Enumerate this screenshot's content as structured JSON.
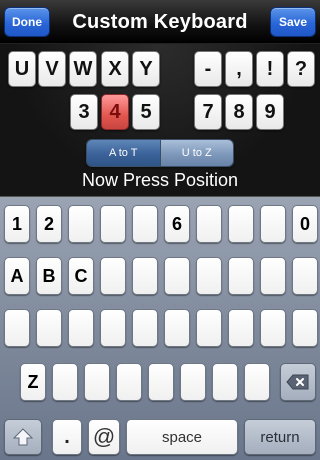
{
  "navbar": {
    "done_label": "Done",
    "title": "Custom Keyboard",
    "save_label": "Save"
  },
  "letters": [
    "U",
    "V",
    "W",
    "X",
    "Y"
  ],
  "symbols": [
    "-",
    ",",
    "!",
    "?"
  ],
  "digits_left": [
    "3",
    "4",
    "5"
  ],
  "digits_right": [
    "7",
    "8",
    "9"
  ],
  "segmented": {
    "left": "A to T",
    "right": "U to Z",
    "selected": "left"
  },
  "prompt": "Now Press Position",
  "keyboard": {
    "row1": [
      "1",
      "2",
      "",
      "",
      "",
      "6",
      "",
      "",
      "",
      "0"
    ],
    "row2": [
      "A",
      "B",
      "C",
      "",
      "",
      "",
      "",
      "",
      "",
      ""
    ],
    "row3": [
      "",
      "",
      "",
      "",
      "",
      "",
      "",
      "",
      "",
      ""
    ],
    "row4": [
      "Z",
      "",
      "",
      "",
      "",
      "",
      "",
      ""
    ],
    "bottom": {
      "period": ".",
      "at": "@",
      "space": "space",
      "return": "return"
    }
  },
  "icons": {
    "shift": "shift-icon",
    "backspace": "backspace-icon"
  },
  "colors": {
    "active_tile": "#e2574f",
    "nav_button": "#2a66d8"
  }
}
